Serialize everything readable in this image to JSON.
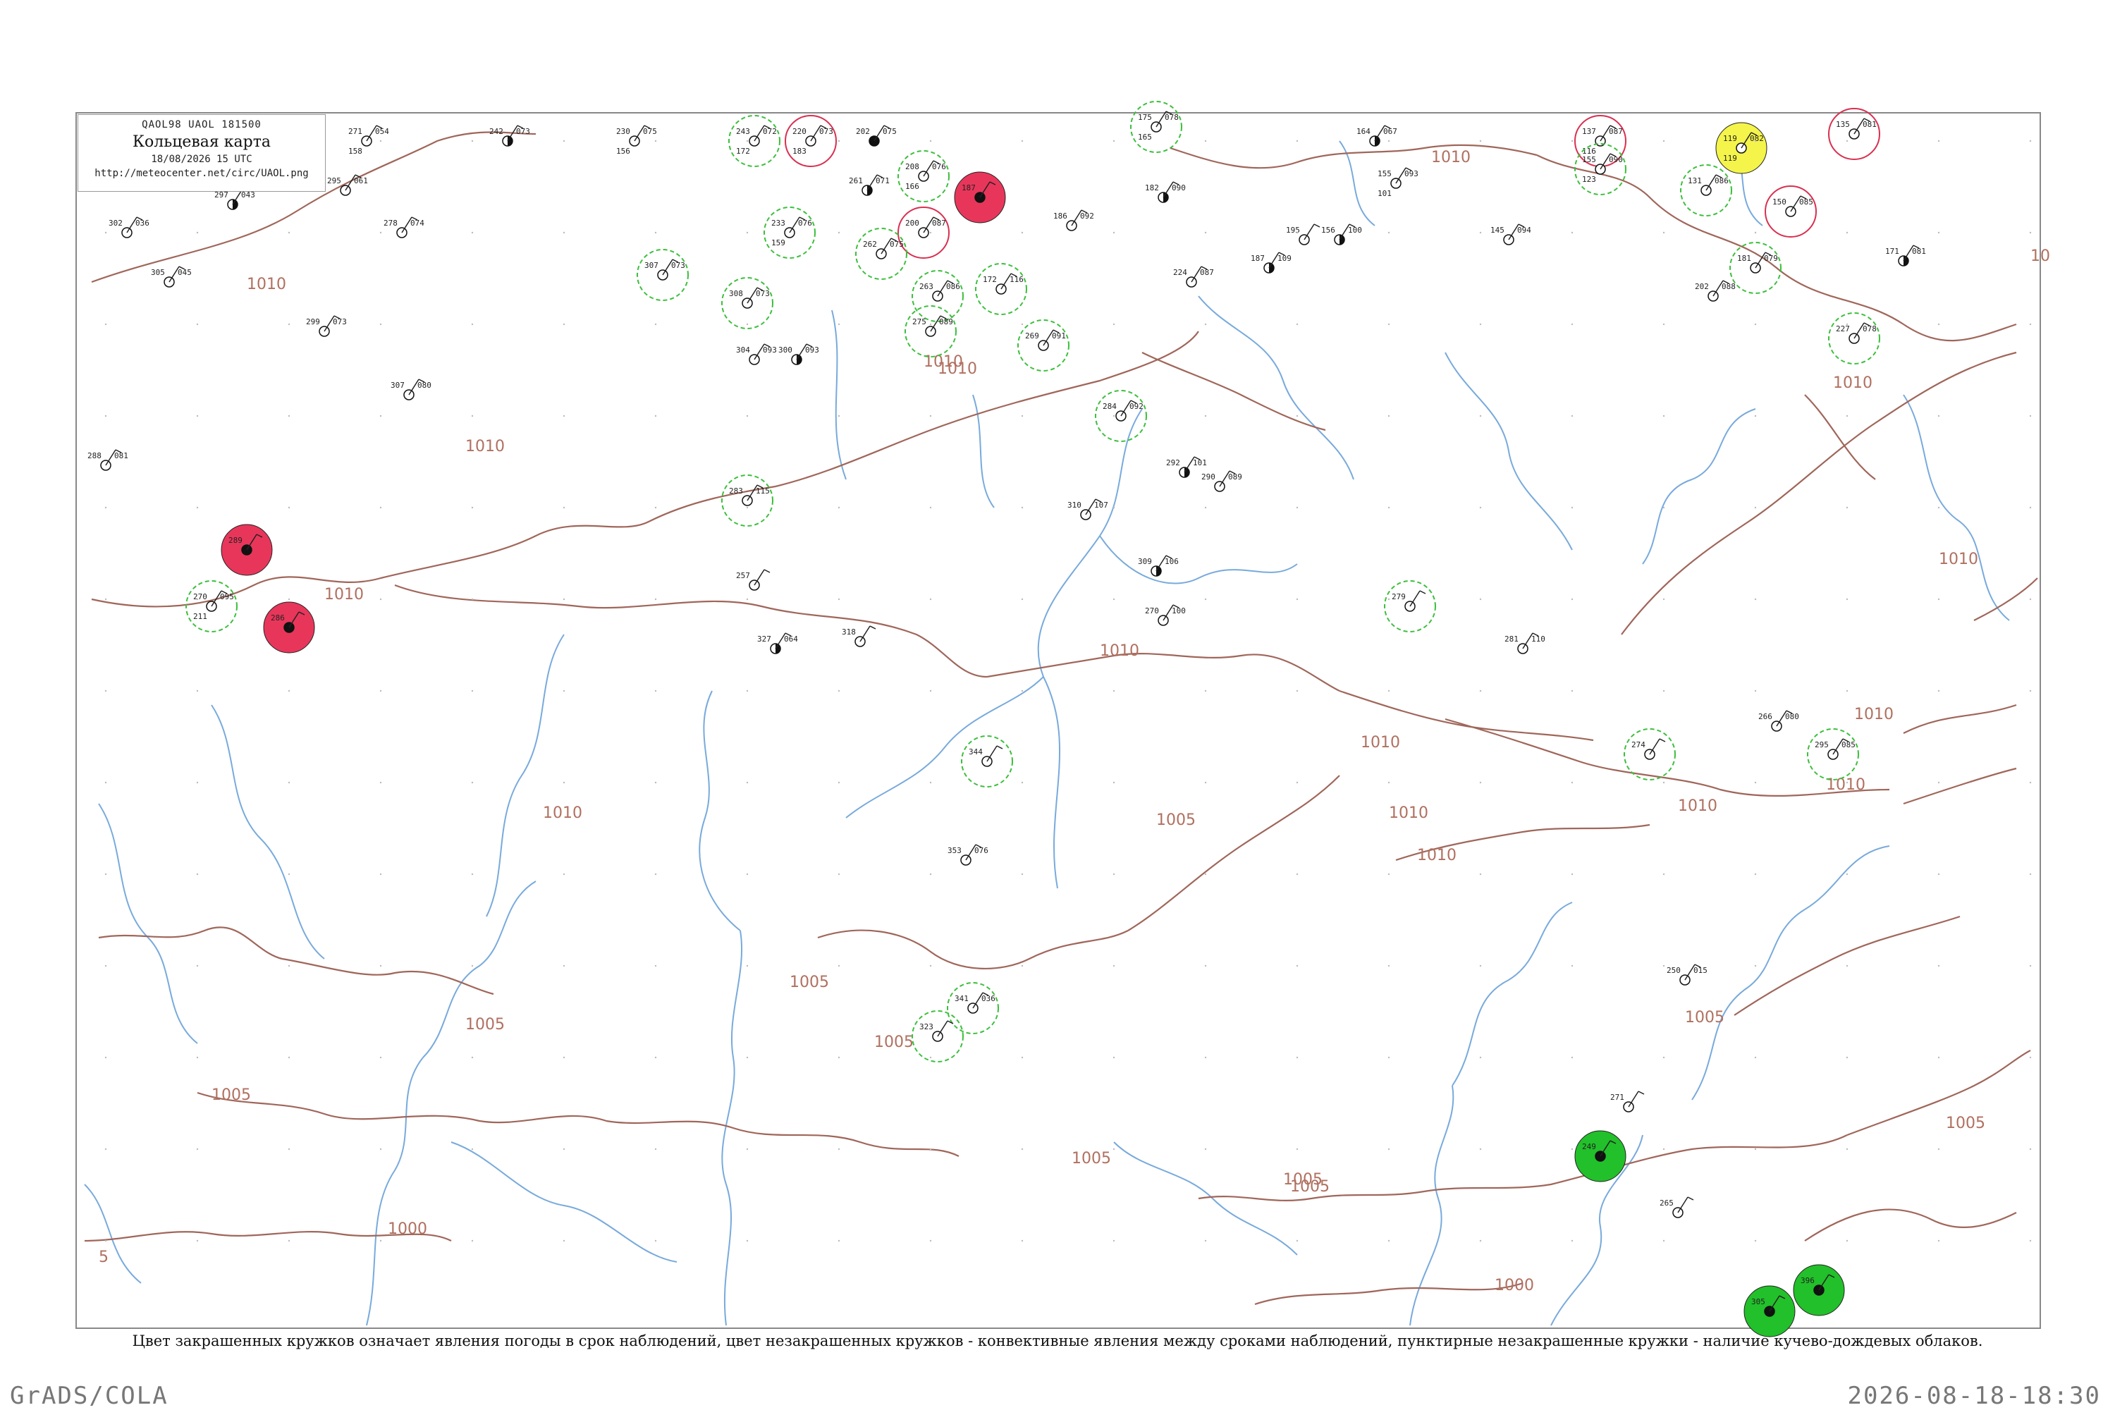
{
  "legend": {
    "codes": "QAOL98  UAOL  181500",
    "title": "Кольцевая карта",
    "time": "18/08/2026 15 UTC",
    "url": "http://meteocenter.net/circ/UAOL.png"
  },
  "caption": "Цвет закрашенных кружков означает явления погоды в срок наблюдений, цвет незакрашенных кружков - конвективные явления между сроками наблюдений, пунктирные незакрашенные кружки - наличие кучево-дождевых облаков.",
  "footer": {
    "left": "GrADS/COLA",
    "right": "2026-08-18-18:30"
  },
  "colors": {
    "isobar": "#a0665a",
    "river": "#78aadc",
    "thunder_fill": "#e8365a",
    "rain_fill": "#22c02a",
    "haze_fill": "#f4f44a",
    "cb_dashed": "#3cbf3c",
    "convective_ring": "#d83050",
    "station_dot": "#111111",
    "frame": "#888888"
  },
  "isobar_labels": [
    "1010",
    "1010",
    "1010",
    "1010",
    "1010",
    "1010",
    "1010",
    "1010",
    "1010",
    "1010",
    "1010",
    "1010",
    "1010",
    "1010",
    "1010",
    "1010",
    "1005",
    "1005",
    "1005",
    "1005",
    "1005",
    "1005",
    "1005",
    "1005",
    "1005",
    "1005",
    "1000",
    "1000",
    "5",
    "10"
  ],
  "stations": [
    {
      "t": "271",
      "p": "054",
      "d": "158",
      "s": "clear"
    },
    {
      "t": "242",
      "p": "073",
      "d": "",
      "s": "half"
    },
    {
      "t": "230",
      "p": "075",
      "d": "156",
      "s": "clear"
    },
    {
      "t": "243",
      "p": "072",
      "d": "172",
      "s": "cb"
    },
    {
      "t": "220",
      "p": "073",
      "d": "183",
      "s": "ring"
    },
    {
      "t": "202",
      "p": "075",
      "d": "",
      "s": "full"
    },
    {
      "t": "175",
      "p": "078",
      "d": "165",
      "s": "cb"
    },
    {
      "t": "164",
      "p": "067",
      "d": "",
      "s": "half"
    },
    {
      "t": "137",
      "p": "087",
      "d": "116",
      "s": "ring"
    },
    {
      "t": "119",
      "p": "082",
      "d": "119",
      "s": "haze"
    },
    {
      "t": "135",
      "p": "081",
      "d": "",
      "s": "ring"
    },
    {
      "t": "302",
      "p": "036",
      "d": "",
      "s": "clear"
    },
    {
      "t": "297",
      "p": "043",
      "d": "",
      "s": "half"
    },
    {
      "t": "295",
      "p": "061",
      "d": "",
      "s": "clear"
    },
    {
      "t": "261",
      "p": "071",
      "d": "",
      "s": "half"
    },
    {
      "t": "208",
      "p": "076",
      "d": "166",
      "s": "cb"
    },
    {
      "t": "187",
      "p": "",
      "d": "",
      "s": "thunder"
    },
    {
      "t": "182",
      "p": "090",
      "d": "",
      "s": "half"
    },
    {
      "t": "155",
      "p": "093",
      "d": "101",
      "s": "clear"
    },
    {
      "t": "155",
      "p": "090",
      "d": "123",
      "s": "cb"
    },
    {
      "t": "131",
      "p": "086",
      "d": "",
      "s": "cb"
    },
    {
      "t": "150",
      "p": "085",
      "d": "",
      "s": "ring"
    },
    {
      "t": "305",
      "p": "045",
      "d": "",
      "s": "clear"
    },
    {
      "t": "278",
      "p": "074",
      "d": "",
      "s": "clear"
    },
    {
      "t": "233",
      "p": "076",
      "d": "159",
      "s": "cb"
    },
    {
      "t": "200",
      "p": "087",
      "d": "",
      "s": "ring"
    },
    {
      "t": "186",
      "p": "092",
      "d": "",
      "s": "clear"
    },
    {
      "t": "195",
      "p": "",
      "d": "",
      "s": "clear"
    },
    {
      "t": "156",
      "p": "100",
      "d": "",
      "s": "half"
    },
    {
      "t": "145",
      "p": "094",
      "d": "",
      "s": "clear"
    },
    {
      "t": "171",
      "p": "081",
      "d": "",
      "s": "half"
    },
    {
      "t": "307",
      "p": "073",
      "d": "",
      "s": "cb"
    },
    {
      "t": "262",
      "p": "075",
      "d": "",
      "s": "cb"
    },
    {
      "t": "224",
      "p": "087",
      "d": "",
      "s": "clear"
    },
    {
      "t": "172",
      "p": "116",
      "d": "",
      "s": "cb"
    },
    {
      "t": "187",
      "p": "109",
      "d": "",
      "s": "half"
    },
    {
      "t": "181",
      "p": "079",
      "d": "",
      "s": "cb"
    },
    {
      "t": "299",
      "p": "073",
      "d": "",
      "s": "clear"
    },
    {
      "t": "308",
      "p": "073",
      "d": "",
      "s": "cb"
    },
    {
      "t": "263",
      "p": "086",
      "d": "",
      "s": "cb"
    },
    {
      "t": "202",
      "p": "088",
      "d": "",
      "s": "clear"
    },
    {
      "t": "227",
      "p": "078",
      "d": "",
      "s": "cb"
    },
    {
      "t": "304",
      "p": "093",
      "d": "",
      "s": "clear"
    },
    {
      "t": "300",
      "p": "093",
      "d": "",
      "s": "half"
    },
    {
      "t": "275",
      "p": "089",
      "d": "",
      "s": "cb"
    },
    {
      "t": "269",
      "p": "091",
      "d": "",
      "s": "cb"
    },
    {
      "t": "284",
      "p": "092",
      "d": "",
      "s": "cb"
    },
    {
      "t": "307",
      "p": "080",
      "d": "",
      "s": "clear"
    },
    {
      "t": "288",
      "p": "081",
      "d": "",
      "s": "clear"
    },
    {
      "t": "289",
      "p": "",
      "d": "",
      "s": "thunder"
    },
    {
      "t": "283",
      "p": "115",
      "d": "",
      "s": "cb"
    },
    {
      "t": "310",
      "p": "107",
      "d": "",
      "s": "clear"
    },
    {
      "t": "292",
      "p": "101",
      "d": "",
      "s": "half"
    },
    {
      "t": "290",
      "p": "089",
      "d": "",
      "s": "clear"
    },
    {
      "t": "270",
      "p": "095",
      "d": "211",
      "s": "cb"
    },
    {
      "t": "286",
      "p": "",
      "d": "",
      "s": "thunder"
    },
    {
      "t": "257",
      "p": "",
      "d": "",
      "s": "clear"
    },
    {
      "t": "327",
      "p": "064",
      "d": "",
      "s": "half"
    },
    {
      "t": "318",
      "p": "",
      "d": "",
      "s": "clear"
    },
    {
      "t": "309",
      "p": "106",
      "d": "",
      "s": "half"
    },
    {
      "t": "270",
      "p": "100",
      "d": "",
      "s": "clear"
    },
    {
      "t": "281",
      "p": "110",
      "d": "",
      "s": "clear"
    },
    {
      "t": "279",
      "p": "",
      "d": "",
      "s": "cb"
    },
    {
      "t": "295",
      "p": "085",
      "d": "",
      "s": "cb"
    },
    {
      "t": "266",
      "p": "080",
      "d": "",
      "s": "clear"
    },
    {
      "t": "274",
      "p": "",
      "d": "",
      "s": "cb"
    },
    {
      "t": "344",
      "p": "",
      "d": "",
      "s": "cb"
    },
    {
      "t": "341",
      "p": "036",
      "d": "",
      "s": "cb"
    },
    {
      "t": "323",
      "p": "",
      "d": "",
      "s": "cb"
    },
    {
      "t": "353",
      "p": "076",
      "d": "",
      "s": "clear"
    },
    {
      "t": "396",
      "p": "",
      "d": "",
      "s": "rain"
    },
    {
      "t": "265",
      "p": "",
      "d": "",
      "s": "clear"
    },
    {
      "t": "250",
      "p": "015",
      "d": "",
      "s": "clear"
    },
    {
      "t": "305",
      "p": "",
      "d": "",
      "s": "rain"
    },
    {
      "t": "271",
      "p": "",
      "d": "",
      "s": "clear"
    },
    {
      "t": "249",
      "p": "",
      "d": "",
      "s": "rain"
    }
  ]
}
